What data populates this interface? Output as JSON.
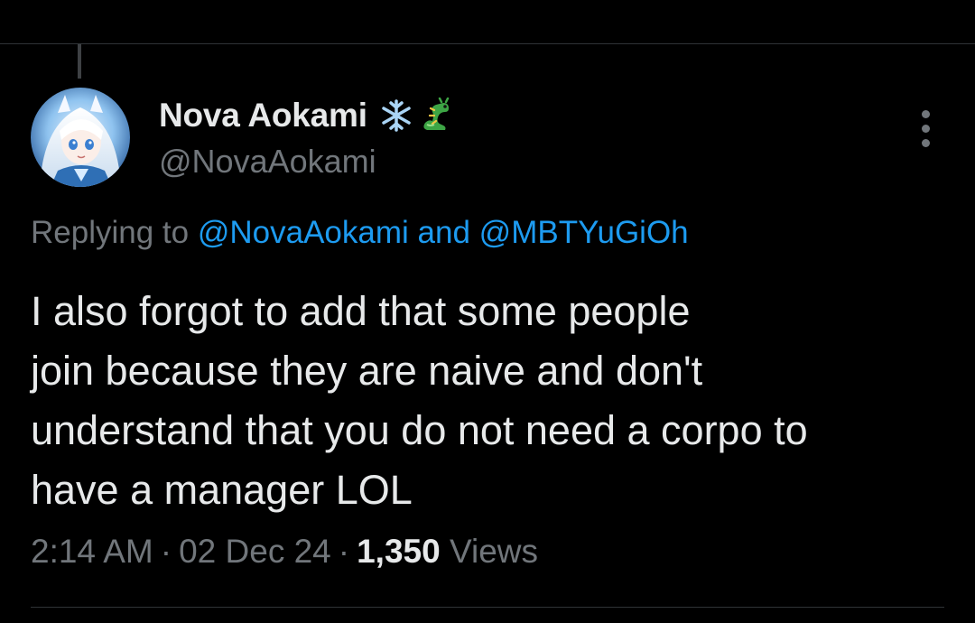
{
  "tweet": {
    "author": {
      "display_name": "Nova Aokami",
      "handle": "@NovaAokami",
      "name_emojis": [
        "snowflake-icon",
        "dragon-icon"
      ]
    },
    "reply_context": {
      "prefix": "Replying to",
      "mention_1": "@NovaAokami",
      "connector": "and",
      "mention_2": "@MBTYuGiOh"
    },
    "text_lines": [
      "I also forgot to add that some people",
      "join because they are naive and don't",
      "understand that you do not need a corpo to",
      "have a manager LOL"
    ],
    "meta": {
      "time": "2:14 AM",
      "separator": "·",
      "date": "02 Dec 24",
      "views_count": "1,350",
      "views_label": "Views"
    }
  },
  "colors": {
    "background": "#000000",
    "text_primary": "#e7e9ea",
    "text_secondary": "#71767b",
    "link": "#1d9bf0",
    "divider": "#2f3336"
  }
}
